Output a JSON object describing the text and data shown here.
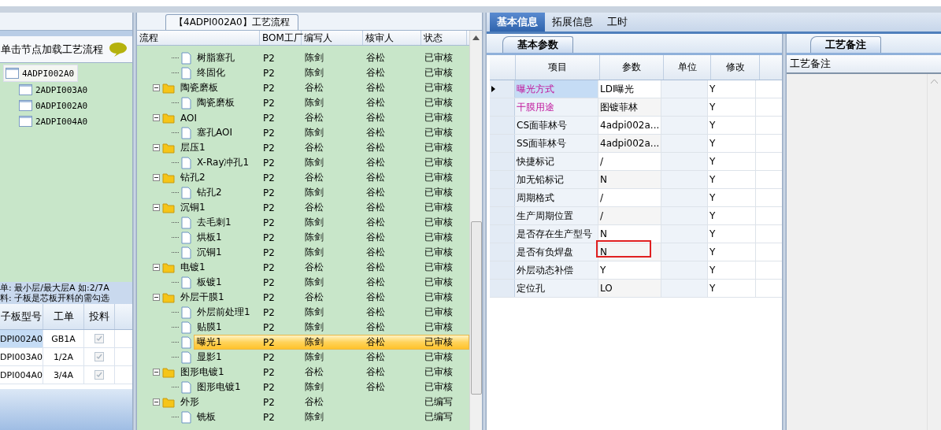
{
  "board_panel": {
    "hint": "单击节点加载工艺流程",
    "tree": [
      {
        "label": "4ADPI002A0",
        "selected": true,
        "children": [
          {
            "label": "2ADPI003A0",
            "selected": false
          },
          {
            "label": "0ADPI002A0",
            "selected": false
          },
          {
            "label": "2ADPI004A0",
            "selected": false
          }
        ]
      }
    ],
    "notes": [
      "单: 最小层/最大层A 如:2/7A",
      "料: 子板是芯板开料的需勾选"
    ],
    "columns": [
      "子板型号",
      "工单",
      "投料"
    ],
    "rows": [
      {
        "model": "DPI002A0",
        "order": "GB1A",
        "checked": true,
        "selected": true
      },
      {
        "model": "DPI003A0",
        "order": "1/2A",
        "checked": true,
        "selected": false
      },
      {
        "model": "DPI004A0",
        "order": "3/4A",
        "checked": true,
        "selected": false
      }
    ]
  },
  "process_panel": {
    "tab": "【4ADPI002A0】工艺流程",
    "columns": [
      "流程",
      "BOM工厂",
      "编写人",
      "核审人",
      "状态"
    ],
    "rows": [
      {
        "children": [
          {
            "name": "树脂塞孔",
            "factory": "P2",
            "writer": "陈剑",
            "reviewer": "谷松",
            "status": "已审核",
            "selected": false
          },
          {
            "name": "终固化",
            "factory": "P2",
            "writer": "陈剑",
            "reviewer": "谷松",
            "status": "已审核",
            "selected": false
          }
        ]
      },
      {
        "name": "陶瓷磨板",
        "factory": "P2",
        "writer": "谷松",
        "reviewer": "谷松",
        "status": "已审核",
        "selected": false,
        "children": [
          {
            "name": "陶瓷磨板",
            "factory": "P2",
            "writer": "陈剑",
            "reviewer": "谷松",
            "status": "已审核",
            "selected": false
          }
        ]
      },
      {
        "name": "AOI",
        "factory": "P2",
        "writer": "谷松",
        "reviewer": "谷松",
        "status": "已审核",
        "selected": false,
        "children": [
          {
            "name": "塞孔AOI",
            "factory": "P2",
            "writer": "陈剑",
            "reviewer": "谷松",
            "status": "已审核",
            "selected": false
          }
        ]
      },
      {
        "name": "层压1",
        "factory": "P2",
        "writer": "谷松",
        "reviewer": "谷松",
        "status": "已审核",
        "selected": false,
        "children": [
          {
            "name": "X-Ray冲孔1",
            "factory": "P2",
            "writer": "陈剑",
            "reviewer": "谷松",
            "status": "已审核",
            "selected": false
          }
        ]
      },
      {
        "name": "钻孔2",
        "factory": "P2",
        "writer": "谷松",
        "reviewer": "谷松",
        "status": "已审核",
        "selected": false,
        "children": [
          {
            "name": "钻孔2",
            "factory": "P2",
            "writer": "陈剑",
            "reviewer": "谷松",
            "status": "已审核",
            "selected": false
          }
        ]
      },
      {
        "name": "沉铜1",
        "factory": "P2",
        "writer": "谷松",
        "reviewer": "谷松",
        "status": "已审核",
        "selected": false,
        "children": [
          {
            "name": "去毛刺1",
            "factory": "P2",
            "writer": "陈剑",
            "reviewer": "谷松",
            "status": "已审核",
            "selected": false
          },
          {
            "name": "烘板1",
            "factory": "P2",
            "writer": "陈剑",
            "reviewer": "谷松",
            "status": "已审核",
            "selected": false
          },
          {
            "name": "沉铜1",
            "factory": "P2",
            "writer": "陈剑",
            "reviewer": "谷松",
            "status": "已审核",
            "selected": false
          }
        ]
      },
      {
        "name": "电镀1",
        "factory": "P2",
        "writer": "谷松",
        "reviewer": "谷松",
        "status": "已审核",
        "selected": false,
        "children": [
          {
            "name": "板镀1",
            "factory": "P2",
            "writer": "陈剑",
            "reviewer": "谷松",
            "status": "已审核",
            "selected": false
          }
        ]
      },
      {
        "name": "外层干膜1",
        "factory": "P2",
        "writer": "谷松",
        "reviewer": "谷松",
        "status": "已审核",
        "selected": false,
        "children": [
          {
            "name": "外层前处理1",
            "factory": "P2",
            "writer": "陈剑",
            "reviewer": "谷松",
            "status": "已审核",
            "selected": false
          },
          {
            "name": "贴膜1",
            "factory": "P2",
            "writer": "陈剑",
            "reviewer": "谷松",
            "status": "已审核",
            "selected": false
          },
          {
            "name": "曝光1",
            "factory": "P2",
            "writer": "陈剑",
            "reviewer": "谷松",
            "status": "已审核",
            "selected": true
          },
          {
            "name": "显影1",
            "factory": "P2",
            "writer": "陈剑",
            "reviewer": "谷松",
            "status": "已审核",
            "selected": false
          }
        ]
      },
      {
        "name": "图形电镀1",
        "factory": "P2",
        "writer": "谷松",
        "reviewer": "谷松",
        "status": "已审核",
        "selected": false,
        "children": [
          {
            "name": "图形电镀1",
            "factory": "P2",
            "writer": "陈剑",
            "reviewer": "谷松",
            "status": "已审核",
            "selected": false
          }
        ]
      },
      {
        "name": "外形",
        "factory": "P2",
        "writer": "谷松",
        "status": "已编写",
        "selected": false,
        "children": [
          {
            "name": "铣板",
            "factory": "P2",
            "writer": "陈剑",
            "status": "已编写",
            "selected": false
          }
        ]
      }
    ]
  },
  "detail": {
    "tabs": [
      {
        "label": "基本信息",
        "selected": true
      },
      {
        "label": "拓展信息",
        "selected": false
      },
      {
        "label": "工时",
        "selected": false
      }
    ],
    "subtab": "基本参数",
    "columns": [
      "项目",
      "参数",
      "单位",
      "修改"
    ],
    "rows": [
      {
        "item": "曝光方式",
        "value": "LDI曝光",
        "modify": "Y",
        "required": true,
        "selected": true,
        "flagged": false
      },
      {
        "item": "干膜用途",
        "value": "图镀菲林",
        "modify": "Y",
        "required": true,
        "selected": false,
        "flagged": false
      },
      {
        "item": "CS面菲林号",
        "value": "4adpi002a...",
        "modify": "Y",
        "required": false,
        "selected": false,
        "flagged": false
      },
      {
        "item": "SS面菲林号",
        "value": "4adpi002a...",
        "modify": "Y",
        "required": false,
        "selected": false,
        "flagged": false
      },
      {
        "item": "快捷标记",
        "value": "/",
        "modify": "Y",
        "required": false,
        "selected": false,
        "flagged": false
      },
      {
        "item": "加无铅标记",
        "value": "N",
        "modify": "Y",
        "required": false,
        "selected": false,
        "flagged": false
      },
      {
        "item": "周期格式",
        "value": "/",
        "modify": "Y",
        "required": false,
        "selected": false,
        "flagged": false
      },
      {
        "item": "生产周期位置",
        "value": "/",
        "modify": "Y",
        "required": false,
        "selected": false,
        "flagged": false
      },
      {
        "item": "是否存在生产型号",
        "value": "N",
        "modify": "Y",
        "required": false,
        "selected": false,
        "flagged": false
      },
      {
        "item": "是否有负焊盘",
        "value": "N",
        "modify": "Y",
        "required": false,
        "selected": false,
        "flagged": true
      },
      {
        "item": "外层动态补偿",
        "value": "Y",
        "modify": "Y",
        "required": false,
        "selected": false,
        "flagged": false
      },
      {
        "item": "定位孔",
        "value": "LO",
        "modify": "Y",
        "required": false,
        "selected": false,
        "flagged": false
      }
    ]
  },
  "remarks": {
    "tab": "工艺备注",
    "header": "工艺备注"
  }
}
